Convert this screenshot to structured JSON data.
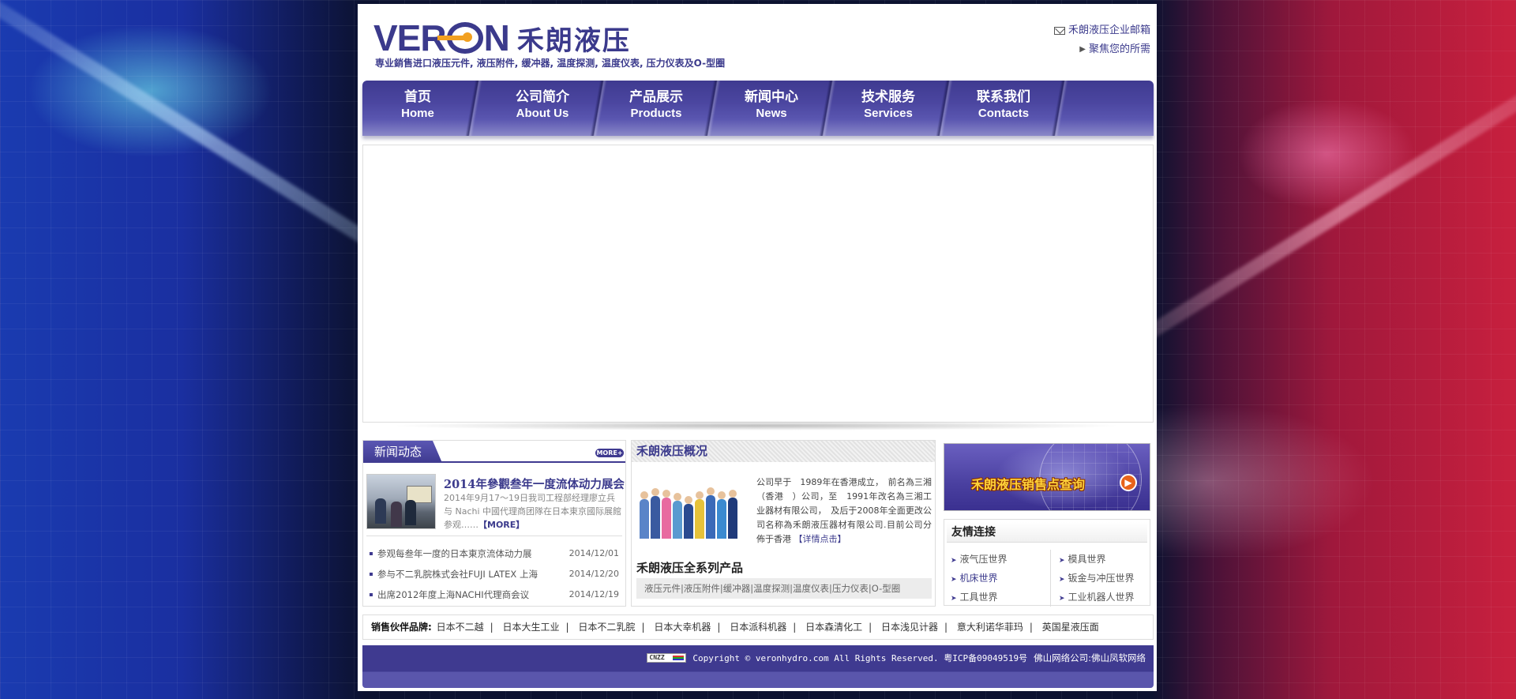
{
  "header": {
    "logo_en": "VER",
    "logo_en_end": "N",
    "logo_cn": "禾朗液压",
    "slogan": "専业銷售进口液压元件, 液压附件, 缓冲器, 温度探测, 温度仪表, 压力仪表及O-型圈",
    "mail_link": "禾朗液压企业邮箱",
    "focus_link": "聚焦您的所需"
  },
  "nav": [
    {
      "cn": "首页",
      "en": "Home"
    },
    {
      "cn": "公司简介",
      "en": "About Us"
    },
    {
      "cn": "产品展示",
      "en": "Products"
    },
    {
      "cn": "新闻中心",
      "en": "News"
    },
    {
      "cn": "技术服务",
      "en": "Services"
    },
    {
      "cn": "联系我们",
      "en": "Contacts"
    }
  ],
  "news": {
    "title": "新闻动态",
    "more": "MORE+",
    "top_title": "2014年參觀叁年一度流体动力展会",
    "top_text": "2014年9月17～19日我司工程部经理廖立兵与 Nachi 中國代理商团隊在日本東京國际展館参观……",
    "top_more": "【MORE】",
    "items": [
      {
        "title": "参观每叁年一度的日本東京流体动力展",
        "date": "2014/12/01"
      },
      {
        "title": "参与不二乳脘株式会社FUJI LATEX 上海",
        "date": "2014/12/20"
      },
      {
        "title": "出席2012年度上海NACHI代理商会议",
        "date": "2014/12/19"
      }
    ]
  },
  "about": {
    "title": "禾朗液压概况",
    "text": "公司早于　1989年在香港成立，　前名為三湘（香港　）公司，至　1991年改名為三湘工业器材有限公司，　及后于2008年全面更改公司名称為禾朗液压器材有限公司.目前公司分佈于香港",
    "detail": "【详情点击】",
    "series_title": "禾朗液压全系列产品",
    "series": "液压元件|液压附件|缓冲器|温度探测|温度仪表|压力仪表|O-型圈"
  },
  "sales": {
    "banner_text": "禾朗液压销售点查询"
  },
  "links": {
    "title": "友情连接",
    "left": [
      "液气压世界",
      "机床世界",
      "工具世界"
    ],
    "right": [
      "模具世界",
      "钣金与冲压世界",
      "工业机器人世界"
    ]
  },
  "brands": {
    "label": "销售伙伴品牌:",
    "items": [
      "日本不二越",
      "日本大生工业",
      "日本不二乳脘",
      "日本大幸机器",
      "日本派科机器",
      "日本森清化工",
      "日本浅见计器",
      "意大利诺华菲玛",
      "英国星液压面"
    ]
  },
  "footer": {
    "badge": "CNZZ",
    "copyright": "Copyright © veronhydro.com All Rights Reserved. 粤ICP备09049519号",
    "agency": "佛山网络公司:佛山凤软网络"
  },
  "colors": {
    "brand": "#3f3a90",
    "accent": "#f2a020"
  }
}
